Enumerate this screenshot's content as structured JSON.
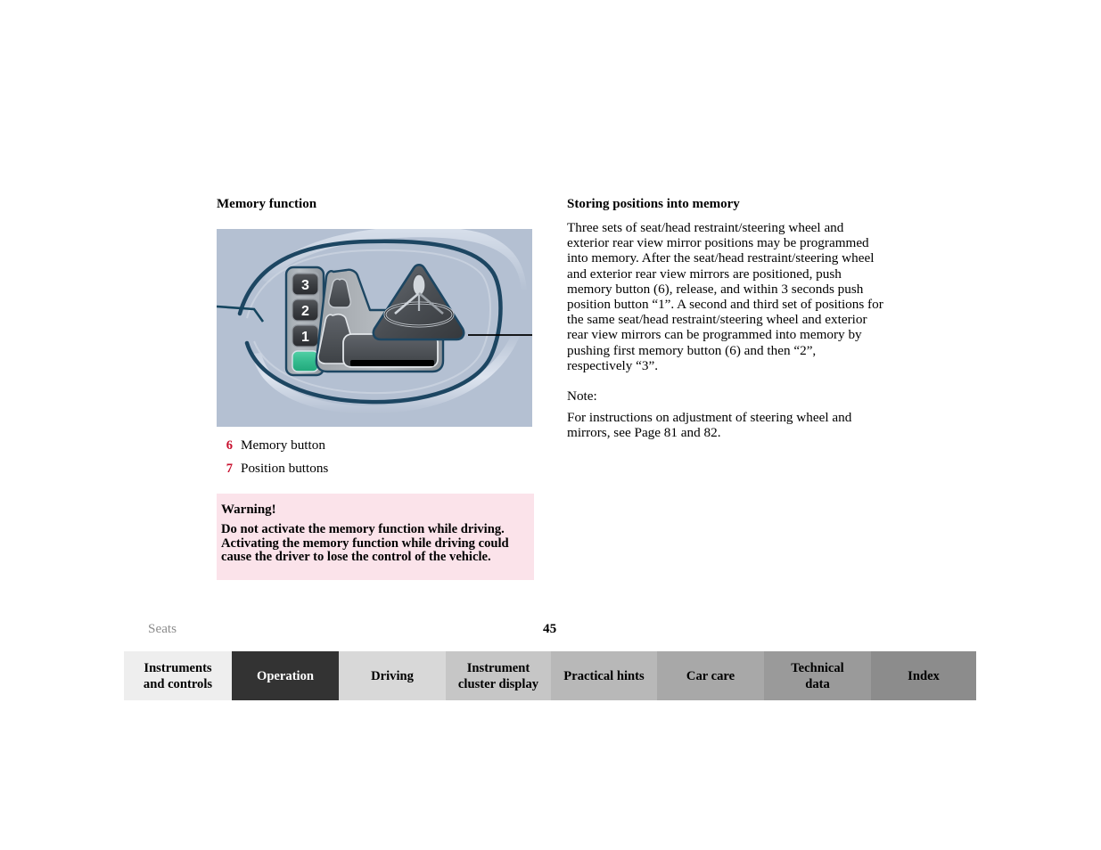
{
  "document": {
    "left_column": {
      "heading": "Memory function",
      "legend": [
        {
          "number": "6",
          "label": "Memory button"
        },
        {
          "number": "7",
          "label": "Position buttons"
        }
      ],
      "warning": {
        "title": "Warning!",
        "text": "Do not activate the memory function while driving. Activating the memory function while driving could cause the driver to lose the control of the vehicle."
      }
    },
    "right_column": {
      "heading": "Storing positions into memory",
      "paragraph": "Three sets of seat/head restraint/steering wheel and exterior rear view mirror positions may be programmed into memory. After the seat/head restraint/steering wheel and exterior rear view mirrors are positioned, push memory button (6), release, and within 3 seconds push position button “1”. A second and third set of positions for the same seat/head restraint/steering wheel and exterior rear view mirrors can be programmed into memory by pushing first memory button (6) and then “2”, respectively “3”.",
      "note_label": "Note:",
      "note_text": "For instructions on adjustment of steering wheel and mirrors, see Page 81 and 82."
    },
    "illustration": {
      "background_color": "#b4c0d2",
      "outline_color": "#1d4662",
      "memory_button_color": "#3cbf94",
      "position_button_color": "#3f4246",
      "position_button_labels": [
        "3",
        "2",
        "1"
      ],
      "seat_icon_color": "#8e9296",
      "steering_wheel_icon_color": "#55585c"
    },
    "footer": {
      "chapter": "Seats",
      "page_number": "45",
      "tabs": [
        {
          "label_line1": "Instruments",
          "label_line2": "and controls",
          "bg": "#eeeeee",
          "fg": "#000000",
          "active": false
        },
        {
          "label_line1": "Operation",
          "label_line2": "",
          "bg": "#333333",
          "fg": "#ffffff",
          "active": true
        },
        {
          "label_line1": "Driving",
          "label_line2": "",
          "bg": "#d8d8d8",
          "fg": "#000000",
          "active": false
        },
        {
          "label_line1": "Instrument",
          "label_line2": "cluster display",
          "bg": "#c6c6c6",
          "fg": "#000000",
          "active": false
        },
        {
          "label_line1": "Practical hints",
          "label_line2": "",
          "bg": "#b8b8b8",
          "fg": "#000000",
          "active": false
        },
        {
          "label_line1": "Car care",
          "label_line2": "",
          "bg": "#a8a8a8",
          "fg": "#000000",
          "active": false
        },
        {
          "label_line1": "Technical",
          "label_line2": "data",
          "bg": "#9a9a9a",
          "fg": "#000000",
          "active": false
        },
        {
          "label_line1": "Index",
          "label_line2": "",
          "bg": "#8c8c8c",
          "fg": "#000000",
          "active": false
        }
      ]
    }
  }
}
